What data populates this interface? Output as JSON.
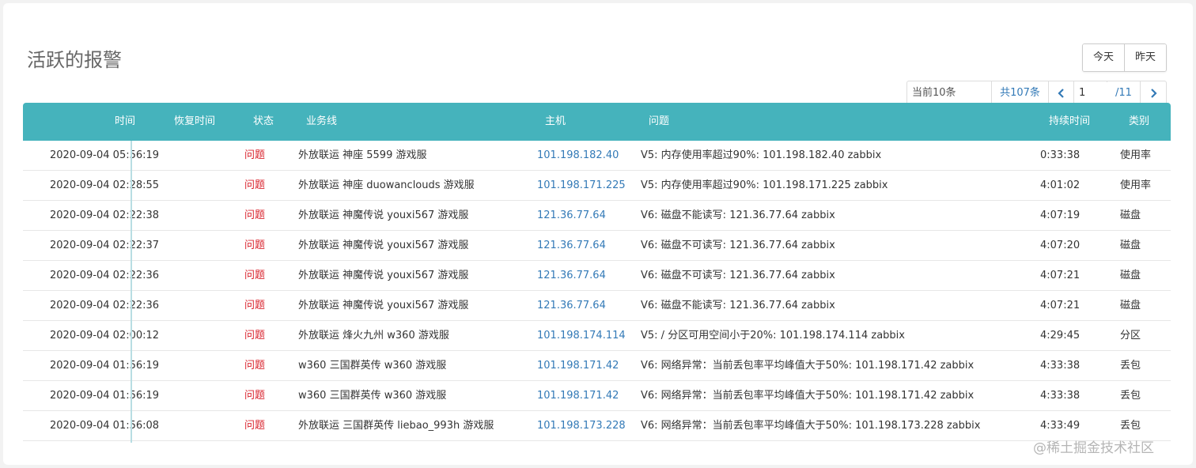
{
  "page": {
    "title": "活跃的报警"
  },
  "day_toggle": {
    "today": "今天",
    "yesterday": "昨天"
  },
  "pager": {
    "current_count": "当前10条",
    "total": "共107条",
    "page_value": "1",
    "page_total": "/11",
    "prev_icon": "chevron-left-icon",
    "next_icon": "chevron-right-icon"
  },
  "table": {
    "columns": [
      "时间",
      "恢复时间",
      "状态",
      "业务线",
      "主机",
      "问题",
      "持续时间",
      "类别"
    ],
    "rows": [
      {
        "time": "2020-09-04 05:56:19",
        "recovery": "",
        "status": "问题",
        "biz": "外放联运 神座 5599 游戏服",
        "host": "101.198.182.40",
        "issue": "V5: 内存使用率超过90%: 101.198.182.40 zabbix",
        "duration": "0:33:38",
        "category": "使用率"
      },
      {
        "time": "2020-09-04 02:28:55",
        "recovery": "",
        "status": "问题",
        "biz": "外放联运 神座 duowanclouds 游戏服",
        "host": "101.198.171.225",
        "issue": "V5: 内存使用率超过90%: 101.198.171.225 zabbix",
        "duration": "4:01:02",
        "category": "使用率"
      },
      {
        "time": "2020-09-04 02:22:38",
        "recovery": "",
        "status": "问题",
        "biz": "外放联运 神魔传说 youxi567 游戏服",
        "host": "121.36.77.64",
        "issue": "V6: 磁盘不能读写: 121.36.77.64 zabbix",
        "duration": "4:07:19",
        "category": "磁盘"
      },
      {
        "time": "2020-09-04 02:22:37",
        "recovery": "",
        "status": "问题",
        "biz": "外放联运 神魔传说 youxi567 游戏服",
        "host": "121.36.77.64",
        "issue": "V6: 磁盘不可读写: 121.36.77.64 zabbix",
        "duration": "4:07:20",
        "category": "磁盘"
      },
      {
        "time": "2020-09-04 02:22:36",
        "recovery": "",
        "status": "问题",
        "biz": "外放联运 神魔传说 youxi567 游戏服",
        "host": "121.36.77.64",
        "issue": "V6: 磁盘不可读写: 121.36.77.64 zabbix",
        "duration": "4:07:21",
        "category": "磁盘"
      },
      {
        "time": "2020-09-04 02:22:36",
        "recovery": "",
        "status": "问题",
        "biz": "外放联运 神魔传说 youxi567 游戏服",
        "host": "121.36.77.64",
        "issue": "V6: 磁盘不能读写: 121.36.77.64 zabbix",
        "duration": "4:07:21",
        "category": "磁盘"
      },
      {
        "time": "2020-09-04 02:00:12",
        "recovery": "",
        "status": "问题",
        "biz": "外放联运 烽火九州 w360 游戏服",
        "host": "101.198.174.114",
        "issue": "V5: / 分区可用空间小于20%: 101.198.174.114 zabbix",
        "duration": "4:29:45",
        "category": "分区"
      },
      {
        "time": "2020-09-04 01:56:19",
        "recovery": "",
        "status": "问题",
        "biz": "w360 三国群英传 w360 游戏服",
        "host": "101.198.171.42",
        "issue": "V6: 网络异常：当前丢包率平均峰值大于50%: 101.198.171.42 zabbix",
        "duration": "4:33:38",
        "category": "丢包"
      },
      {
        "time": "2020-09-04 01:56:19",
        "recovery": "",
        "status": "问题",
        "biz": "w360 三国群英传 w360 游戏服",
        "host": "101.198.171.42",
        "issue": "V6: 网络异常：当前丢包率平均峰值大于50%: 101.198.171.42 zabbix",
        "duration": "4:33:38",
        "category": "丢包"
      },
      {
        "time": "2020-09-04 01:56:08",
        "recovery": "",
        "status": "问题",
        "biz": "外放联运 三国群英传 liebao_993h 游戏服",
        "host": "101.198.173.228",
        "issue": "V6: 网络异常：当前丢包率平均峰值大于50%: 101.198.173.228 zabbix",
        "duration": "4:33:49",
        "category": "丢包"
      }
    ]
  },
  "watermark": "@稀土掘金技术社区"
}
